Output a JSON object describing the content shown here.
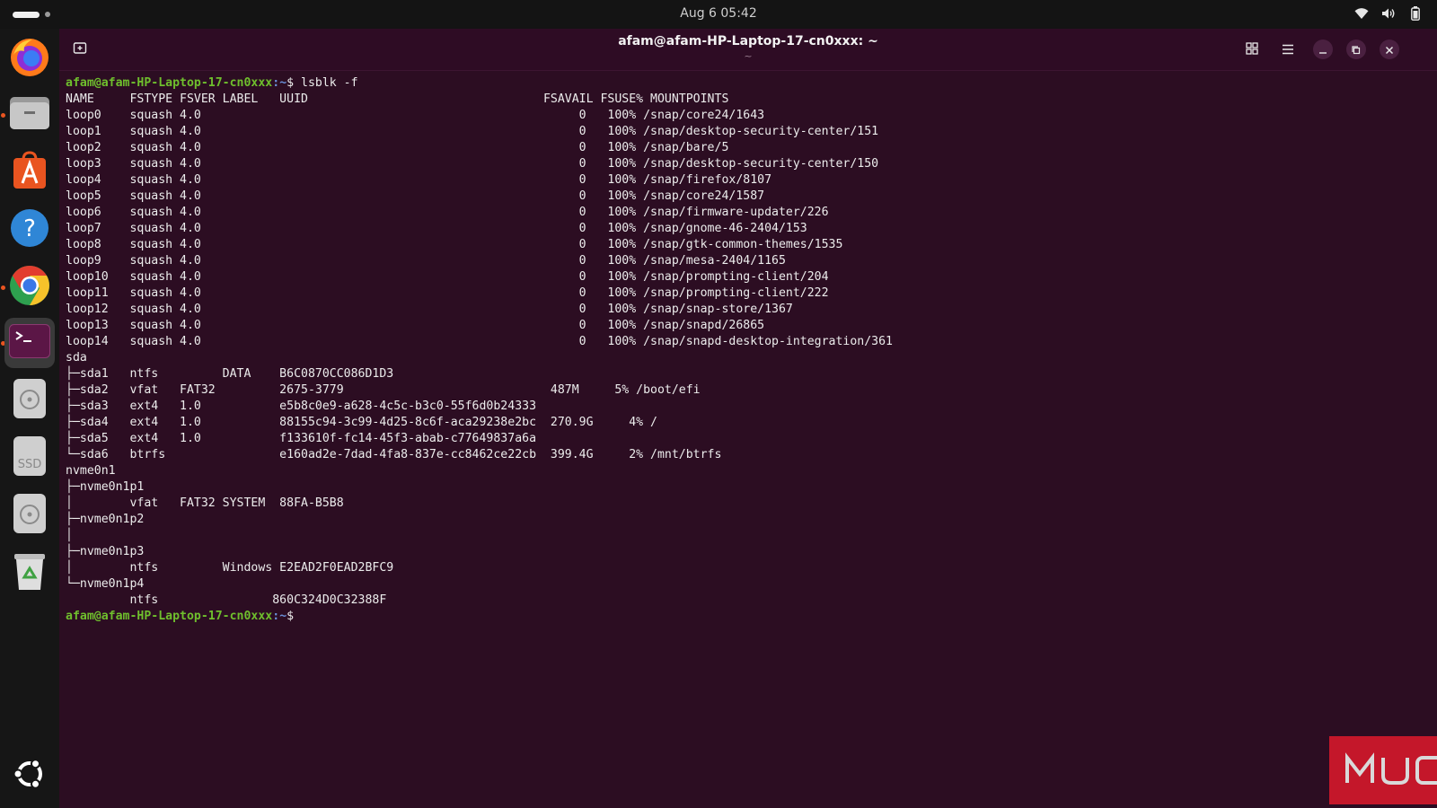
{
  "topbar": {
    "clock": "Aug 6  05:42",
    "tray_icons": [
      "wifi-icon",
      "volume-icon",
      "battery-icon"
    ]
  },
  "dock": {
    "items": [
      {
        "name": "firefox",
        "icon": "firefox-icon",
        "running": true
      },
      {
        "name": "files",
        "icon": "folder-icon",
        "running": true
      },
      {
        "name": "app-center",
        "icon": "app-center-icon",
        "running": false
      },
      {
        "name": "help",
        "icon": "help-icon",
        "running": false
      },
      {
        "name": "chrome",
        "icon": "chrome-icon",
        "running": true
      },
      {
        "name": "terminal",
        "icon": "terminal-icon",
        "running": true,
        "active": true
      },
      {
        "name": "disk-1",
        "icon": "disk-icon",
        "running": false
      },
      {
        "name": "ssd",
        "icon": "ssd-icon",
        "label": "SSD",
        "running": false
      },
      {
        "name": "disk-2",
        "icon": "disk-icon",
        "running": false
      },
      {
        "name": "trash",
        "icon": "trash-icon",
        "running": false
      },
      {
        "name": "show-apps",
        "icon": "ubuntu-logo-icon",
        "running": false
      }
    ]
  },
  "window": {
    "title": "afam@afam-HP-Laptop-17-cn0xxx: ~",
    "subtitle": "~",
    "buttons": [
      "new-tab-icon",
      "grid-icon",
      "menu-icon",
      "minimize-icon",
      "maximize-icon",
      "close-icon"
    ]
  },
  "terminal": {
    "prompt_user": "afam@afam-HP-Laptop-17-cn0xxx",
    "prompt_path": ":~",
    "prompt_symbol": "$",
    "command": " lsblk -f",
    "output": [
      "NAME     FSTYPE FSVER LABEL   UUID                                 FSAVAIL FSUSE% MOUNTPOINTS",
      "loop0    squash 4.0                                                     0   100% /snap/core24/1643",
      "loop1    squash 4.0                                                     0   100% /snap/desktop-security-center/151",
      "loop2    squash 4.0                                                     0   100% /snap/bare/5",
      "loop3    squash 4.0                                                     0   100% /snap/desktop-security-center/150",
      "loop4    squash 4.0                                                     0   100% /snap/firefox/8107",
      "loop5    squash 4.0                                                     0   100% /snap/core24/1587",
      "loop6    squash 4.0                                                     0   100% /snap/firmware-updater/226",
      "loop7    squash 4.0                                                     0   100% /snap/gnome-46-2404/153",
      "loop8    squash 4.0                                                     0   100% /snap/gtk-common-themes/1535",
      "loop9    squash 4.0                                                     0   100% /snap/mesa-2404/1165",
      "loop10   squash 4.0                                                     0   100% /snap/prompting-client/204",
      "loop11   squash 4.0                                                     0   100% /snap/prompting-client/222",
      "loop12   squash 4.0                                                     0   100% /snap/snap-store/1367",
      "loop13   squash 4.0                                                     0   100% /snap/snapd/26865",
      "loop14   squash 4.0                                                     0   100% /snap/snapd-desktop-integration/361",
      "sda",
      "├─sda1   ntfs         DATA    B6C0870CC086D1D3",
      "├─sda2   vfat   FAT32         2675-3779                             487M     5% /boot/efi",
      "├─sda3   ext4   1.0           e5b8c0e9-a628-4c5c-b3c0-55f6d0b24333",
      "├─sda4   ext4   1.0           88155c94-3c99-4d25-8c6f-aca29238e2bc  270.9G     4% /",
      "├─sda5   ext4   1.0           f133610f-fc14-45f3-abab-c77649837a6a",
      "└─sda6   btrfs                e160ad2e-7dad-4fa8-837e-cc8462ce22cb  399.4G     2% /mnt/btrfs",
      "nvme0n1",
      "├─nvme0n1p1",
      "│        vfat   FAT32 SYSTEM  88FA-B5B8",
      "├─nvme0n1p2",
      "│",
      "├─nvme0n1p3",
      "│        ntfs         Windows E2EAD2F0EAD2BFC9",
      "└─nvme0n1p4",
      "         ntfs                860C324D0C32388F"
    ]
  },
  "watermark": {
    "text": "MUO",
    "color": "#c4172a"
  },
  "colors": {
    "terminal_bg": "#2c0d22",
    "prompt_user": "#6fbf2d",
    "prompt_path": "#6a8fd8"
  }
}
